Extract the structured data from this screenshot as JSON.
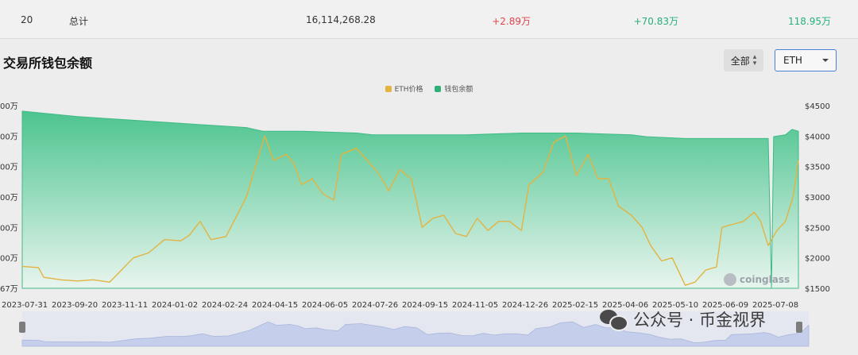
{
  "summary_row": {
    "index": "20",
    "label": "总计",
    "total": "16,114,268.28",
    "change_1": "+2.89万",
    "change_2": "+70.83万",
    "change_3": "118.95万"
  },
  "section_title": "交易所钱包余额",
  "controls": {
    "range_select": "全部",
    "asset_select": "ETH"
  },
  "legend": {
    "series_a": "ETH价格",
    "series_b": "钱包余额"
  },
  "colors": {
    "price": "#e3b341",
    "balance_top": "#4cc48f",
    "balance_bottom": "#e9f5ef",
    "navigator": "#c5ceea",
    "select_border": "#4a7fd6"
  },
  "branding": {
    "logo_text": "coinglass",
    "watermark_text": "公众号 · 币金视界"
  },
  "chart_data": {
    "type": "area",
    "title": "交易所钱包余额",
    "x_tick_labels": [
      "2023-07-31",
      "2023-09-20",
      "2023-11-11",
      "2024-01-02",
      "2024-02-24",
      "2024-04-15",
      "2024-06-05",
      "2024-07-26",
      "2024-09-15",
      "2024-11-05",
      "2024-12-26",
      "2025-02-15",
      "2025-04-06",
      "2025-05-10",
      "2025-06-09",
      "2025-07-08"
    ],
    "y_left_tick_labels": [
      "00万",
      "00万",
      "00万",
      "00万",
      "00万",
      "00万",
      "67万"
    ],
    "y_right_tick_labels": [
      "$4500",
      "$4000",
      "$3500",
      "$3000",
      "$2500",
      "$2000",
      "$1500"
    ],
    "y_right_range": [
      1500,
      4500
    ],
    "series": [
      {
        "name": "ETH价格",
        "axis": "right",
        "points": [
          [
            "2023-07-31",
            1860
          ],
          [
            "2023-08-15",
            1840
          ],
          [
            "2023-08-20",
            1680
          ],
          [
            "2023-09-05",
            1640
          ],
          [
            "2023-09-20",
            1620
          ],
          [
            "2023-10-05",
            1640
          ],
          [
            "2023-10-20",
            1600
          ],
          [
            "2023-10-30",
            1780
          ],
          [
            "2023-11-11",
            2000
          ],
          [
            "2023-11-25",
            2080
          ],
          [
            "2023-12-10",
            2300
          ],
          [
            "2023-12-25",
            2280
          ],
          [
            "2024-01-02",
            2370
          ],
          [
            "2024-01-12",
            2600
          ],
          [
            "2024-01-22",
            2300
          ],
          [
            "2024-02-05",
            2350
          ],
          [
            "2024-02-24",
            3000
          ],
          [
            "2024-03-05",
            3600
          ],
          [
            "2024-03-12",
            4000
          ],
          [
            "2024-03-20",
            3600
          ],
          [
            "2024-04-01",
            3700
          ],
          [
            "2024-04-08",
            3550
          ],
          [
            "2024-04-15",
            3200
          ],
          [
            "2024-04-25",
            3300
          ],
          [
            "2024-05-05",
            3050
          ],
          [
            "2024-05-15",
            2950
          ],
          [
            "2024-05-22",
            3700
          ],
          [
            "2024-06-05",
            3800
          ],
          [
            "2024-06-15",
            3600
          ],
          [
            "2024-06-25",
            3400
          ],
          [
            "2024-07-05",
            3100
          ],
          [
            "2024-07-15",
            3450
          ],
          [
            "2024-07-26",
            3300
          ],
          [
            "2024-08-05",
            2500
          ],
          [
            "2024-08-15",
            2650
          ],
          [
            "2024-08-25",
            2700
          ],
          [
            "2024-09-05",
            2400
          ],
          [
            "2024-09-15",
            2350
          ],
          [
            "2024-09-25",
            2650
          ],
          [
            "2024-10-05",
            2450
          ],
          [
            "2024-10-15",
            2600
          ],
          [
            "2024-10-25",
            2600
          ],
          [
            "2024-11-05",
            2450
          ],
          [
            "2024-11-12",
            3200
          ],
          [
            "2024-11-25",
            3400
          ],
          [
            "2024-12-05",
            3900
          ],
          [
            "2024-12-16",
            4000
          ],
          [
            "2024-12-26",
            3350
          ],
          [
            "2025-01-06",
            3700
          ],
          [
            "2025-01-15",
            3300
          ],
          [
            "2025-01-25",
            3300
          ],
          [
            "2025-02-03",
            2850
          ],
          [
            "2025-02-15",
            2700
          ],
          [
            "2025-02-25",
            2500
          ],
          [
            "2025-03-05",
            2200
          ],
          [
            "2025-03-15",
            1950
          ],
          [
            "2025-03-25",
            2000
          ],
          [
            "2025-04-06",
            1550
          ],
          [
            "2025-04-15",
            1600
          ],
          [
            "2025-04-25",
            1800
          ],
          [
            "2025-05-05",
            1850
          ],
          [
            "2025-05-10",
            2500
          ],
          [
            "2025-05-20",
            2550
          ],
          [
            "2025-05-30",
            2600
          ],
          [
            "2025-06-09",
            2750
          ],
          [
            "2025-06-15",
            2600
          ],
          [
            "2025-06-22",
            2200
          ],
          [
            "2025-06-30",
            2450
          ],
          [
            "2025-07-08",
            2600
          ],
          [
            "2025-07-15",
            3000
          ],
          [
            "2025-07-20",
            3600
          ]
        ]
      },
      {
        "name": "钱包余额",
        "axis": "left",
        "points": [
          [
            "2023-07-31",
            0.97
          ],
          [
            "2023-09-20",
            0.94
          ],
          [
            "2023-11-11",
            0.92
          ],
          [
            "2024-01-02",
            0.9
          ],
          [
            "2024-02-24",
            0.88
          ],
          [
            "2024-03-10",
            0.86
          ],
          [
            "2024-04-15",
            0.86
          ],
          [
            "2024-06-05",
            0.85
          ],
          [
            "2024-06-20",
            0.84
          ],
          [
            "2024-07-26",
            0.84
          ],
          [
            "2024-09-15",
            0.84
          ],
          [
            "2024-11-05",
            0.85
          ],
          [
            "2024-12-26",
            0.85
          ],
          [
            "2025-02-15",
            0.84
          ],
          [
            "2025-03-01",
            0.83
          ],
          [
            "2025-04-06",
            0.82
          ],
          [
            "2025-05-10",
            0.82
          ],
          [
            "2025-06-09",
            0.82
          ],
          [
            "2025-06-22",
            0.82
          ],
          [
            "2025-06-25",
            0.0
          ],
          [
            "2025-06-27",
            0.83
          ],
          [
            "2025-07-08",
            0.84
          ],
          [
            "2025-07-14",
            0.87
          ],
          [
            "2025-07-20",
            0.86
          ]
        ]
      }
    ],
    "grid": false,
    "legend_position": "top-center"
  }
}
